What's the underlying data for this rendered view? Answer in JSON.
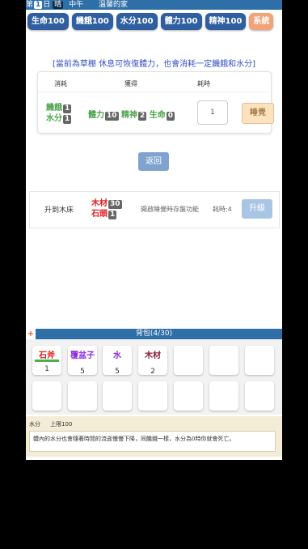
{
  "topbar": {
    "day_prefix": "第",
    "day_num": "1",
    "day_suffix": "日",
    "weather": "晴",
    "time": "中午",
    "location": "溫馨的家"
  },
  "stats": [
    {
      "label": "生命100"
    },
    {
      "label": "饑餓100"
    },
    {
      "label": "水分100"
    },
    {
      "label": "體力100"
    },
    {
      "label": "精神100"
    },
    {
      "label": "系統"
    }
  ],
  "notice": "[當前為草棚 休息可恢復體力，也會消耗一定饑餓和水分]",
  "rest": {
    "headers": {
      "cost": "消耗",
      "gain": "獲得",
      "time": "耗時"
    },
    "cost": [
      {
        "label": "饑餓",
        "value": "1"
      },
      {
        "label": "水分",
        "value": "1"
      }
    ],
    "gain": [
      {
        "label": "體力",
        "value": "10"
      },
      {
        "label": "精神",
        "value": "2"
      },
      {
        "label": "生命",
        "value": "0"
      }
    ],
    "time_value": "1",
    "action": "睡覺"
  },
  "back_label": "返回",
  "upgrade": {
    "name": "升到木床",
    "cost": [
      {
        "label": "木材",
        "value": "30"
      },
      {
        "label": "石頭",
        "value": "1"
      }
    ],
    "desc": "開啟睡覺時存盤功能",
    "time": "耗時:4",
    "button": "升級"
  },
  "backpack": {
    "plus": "+",
    "title": "背包(4/30)",
    "items": [
      {
        "name": "石斧",
        "count": "1",
        "color": "#e02020"
      },
      {
        "name": "覆盆子",
        "count": "5",
        "color": "#8a2be2"
      },
      {
        "name": "水",
        "count": "5",
        "color": "#8a2be2"
      },
      {
        "name": "木材",
        "count": "2",
        "color": "#8b1a3a"
      }
    ]
  },
  "info": {
    "title": "水分",
    "limit": "上限100",
    "desc": "體內的水分也會隨著時間的流逝慢慢下降，同饑餓一樣，水分為0時你就會死亡。"
  }
}
